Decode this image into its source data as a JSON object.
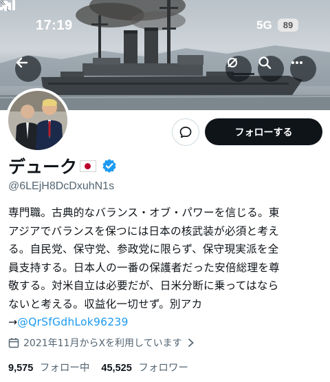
{
  "status_bar": {
    "time": "17:19",
    "network": "5G",
    "battery": "89",
    "icons": [
      "bell-slash-icon",
      "signal-bars-icon"
    ]
  },
  "header": {
    "banner": "battleship-photo",
    "nav_icons": [
      "back-arrow-icon",
      "bell-off-icon",
      "search-icon",
      "more-icon"
    ]
  },
  "profile": {
    "display_name": "デューク",
    "handle": "@6LEjH8DcDxuhN1s",
    "bio_lines": [
      "専門職。古典的なバランス・オブ・パワーを信じる。東",
      "アジアでバランスを保つには日本の核武装が必須と考え",
      "る。自民党、保守党、参政党に限らず、保守現実派を全",
      "員支持する。日本人の一番の保護者だった安倍総理を尊",
      "敬する。対米自立は必要だが、日米分断に乗ってはなら",
      "ないと考える。収益化一切せず。別アカ"
    ],
    "bio_link_prefix": "→",
    "bio_link": "@QrSfGdhLok96239",
    "joined": "2021年11月からXを利用しています",
    "following_count": "9,575",
    "following_label": "フォロー中",
    "followers_count": "45,525",
    "followers_label": "フォロワー"
  },
  "actions": {
    "follow_label": "フォローする",
    "message_icon": "message-icon"
  },
  "colors": {
    "link": "#1d9bf0",
    "verified": "#1d9bf0",
    "follow_button": "#0f1419",
    "secondary_text": "#536471"
  }
}
